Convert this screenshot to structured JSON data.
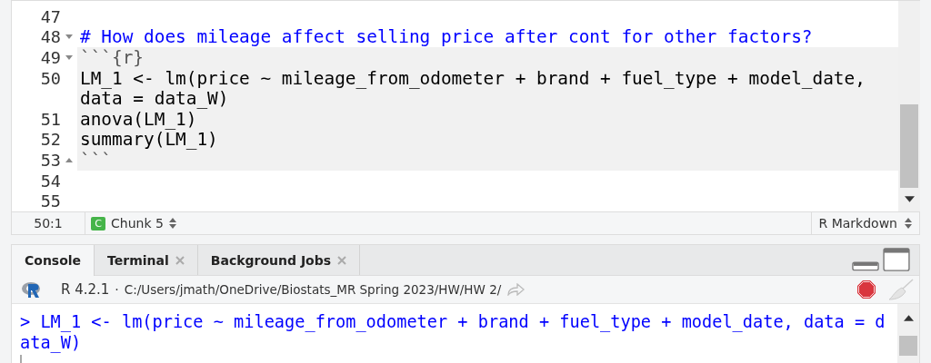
{
  "editor": {
    "lines": [
      {
        "number": "47",
        "fold_start": false,
        "fold_end": false,
        "kind": "text",
        "in_chunk": false
      },
      {
        "number": "48",
        "fold_start": true,
        "fold_end": false,
        "kind": "heading",
        "in_chunk": false,
        "text": "# How does mileage affect selling price after cont for other factors?"
      },
      {
        "number": "49",
        "fold_start": true,
        "fold_end": false,
        "kind": "fence",
        "in_chunk": true,
        "text": "```{r}"
      },
      {
        "number": "50",
        "fold_start": false,
        "fold_end": false,
        "kind": "code",
        "in_chunk": true,
        "text": "LM_1 <- lm(price ~ mileage_from_odometer + brand + fuel_type + model_date,"
      },
      {
        "fold_start": false,
        "fold_end": false,
        "kind": "code",
        "in_chunk": true,
        "text": "data = data_W)"
      },
      {
        "number": "51",
        "fold_start": false,
        "fold_end": false,
        "kind": "code",
        "in_chunk": true,
        "text": "anova(LM_1)"
      },
      {
        "number": "52",
        "fold_start": false,
        "fold_end": false,
        "kind": "code",
        "in_chunk": true,
        "text": "summary(LM_1)"
      },
      {
        "number": "53",
        "fold_start": false,
        "fold_end": true,
        "kind": "fence",
        "in_chunk": true,
        "text": "```"
      },
      {
        "number": "54",
        "fold_start": false,
        "fold_end": false,
        "kind": "text",
        "in_chunk": false
      },
      {
        "number": "55",
        "fold_start": false,
        "fold_end": false,
        "kind": "text",
        "in_chunk": false
      }
    ]
  },
  "status_bar": {
    "position": "50:1",
    "chunk": "Chunk 5",
    "chunk_badge": "C",
    "file_type": "R Markdown"
  },
  "console": {
    "tabs": [
      {
        "label": "Console",
        "selected": true,
        "closable": false
      },
      {
        "label": "Terminal",
        "selected": false,
        "closable": true
      },
      {
        "label": "Background Jobs",
        "selected": false,
        "closable": true
      }
    ],
    "version": "R 4.2.1",
    "separator": "·",
    "path": "C:/Users/jmath/OneDrive/Biostats_MR Spring 2023/HW/HW 2/",
    "output": [
      "> LM_1 <- lm(price ~ mileage_from_odometer + brand + fuel_type + model_date, data = d",
      "ata_W)"
    ]
  }
}
